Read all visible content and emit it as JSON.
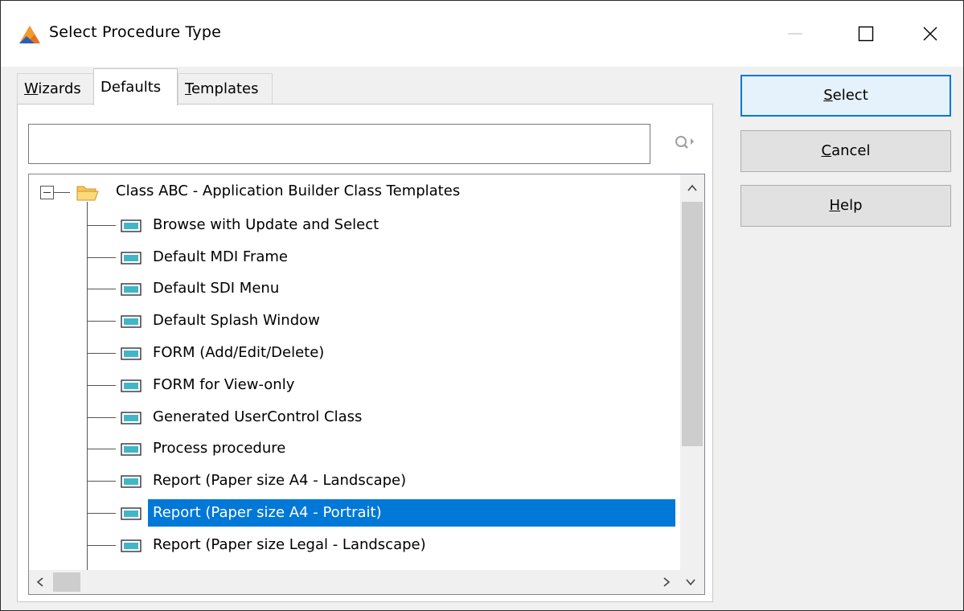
{
  "window": {
    "title": "Select Procedure Type"
  },
  "tabs": [
    {
      "prefix": "",
      "accel": "W",
      "rest": "izards",
      "active": false
    },
    {
      "prefix": "",
      "accel": "D",
      "rest": "efaults",
      "active": true
    },
    {
      "prefix": "",
      "accel": "T",
      "rest": "emplates",
      "active": false
    }
  ],
  "search": {
    "value": "",
    "placeholder": ""
  },
  "tree": {
    "root": {
      "label": "Class ABC - Application Builder Class Templates",
      "expanded": true,
      "icon": "folder-open-icon"
    },
    "items": [
      {
        "label": "Browse with Update and Select",
        "icon": "procedure-icon"
      },
      {
        "label": "Default MDI Frame",
        "icon": "procedure-icon"
      },
      {
        "label": "Default SDI Menu",
        "icon": "procedure-icon"
      },
      {
        "label": "Default Splash Window",
        "icon": "procedure-icon"
      },
      {
        "label": "FORM (Add/Edit/Delete)",
        "icon": "procedure-icon"
      },
      {
        "label": "FORM for View-only",
        "icon": "procedure-icon"
      },
      {
        "label": "Generated UserControl Class",
        "icon": "procedure-icon"
      },
      {
        "label": "Process procedure",
        "icon": "procedure-icon"
      },
      {
        "label": "Report (Paper size A4 - Landscape)",
        "icon": "procedure-icon"
      },
      {
        "label": "Report (Paper size A4 - Portrait)",
        "icon": "procedure-icon",
        "selected": true
      },
      {
        "label": "Report (Paper size Legal - Landscape)",
        "icon": "procedure-icon"
      }
    ]
  },
  "buttons": {
    "select": {
      "accel": "S",
      "rest": "elect"
    },
    "cancel": {
      "accel": "C",
      "rest": "ancel"
    },
    "help": {
      "accel": "H",
      "rest": "elp"
    }
  },
  "colors": {
    "selection": "#0078d7",
    "app_icon_orange": "#e8711c",
    "app_icon_blue": "#2a5fb8",
    "procedure_icon_teal": "#41b6c6"
  }
}
